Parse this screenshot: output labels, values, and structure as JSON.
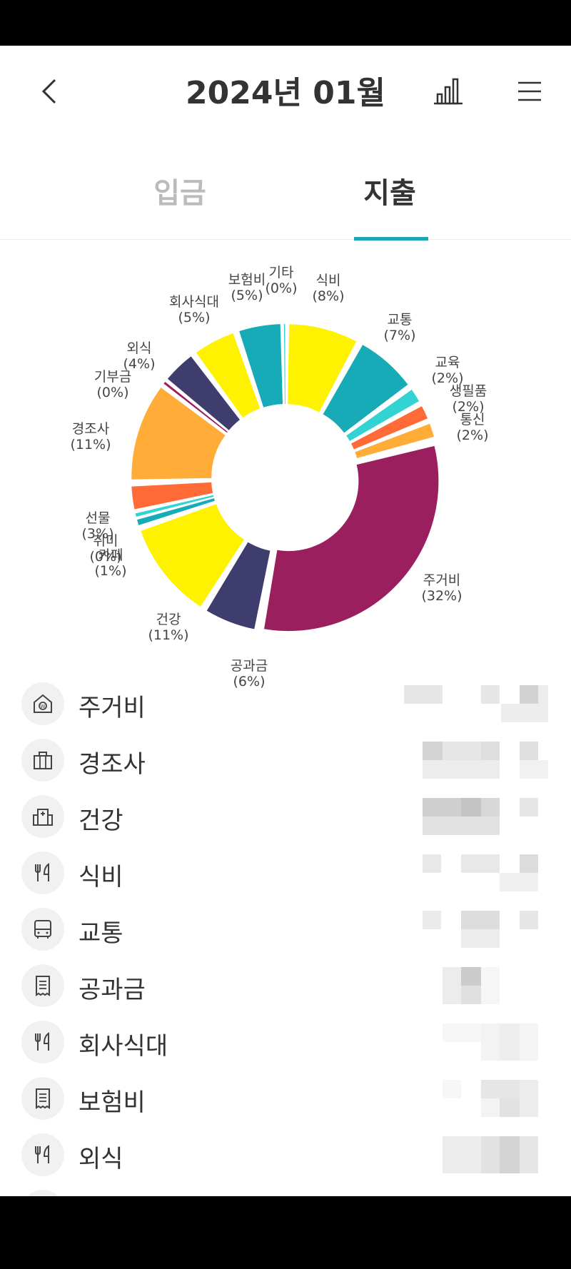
{
  "header": {
    "title": "2024년 01월",
    "back_icon": "chevron-left-icon",
    "chart_icon": "bar-chart-icon",
    "menu_icon": "hamburger-menu-icon"
  },
  "tabs": [
    {
      "label": "입금",
      "active": false
    },
    {
      "label": "지출",
      "active": true
    }
  ],
  "colors": {
    "accent": "#1aa6b5",
    "active_tab": "#333333",
    "inactive_tab": "#bbbbbb"
  },
  "chart_data": {
    "type": "pie",
    "style": "donut",
    "slices": [
      {
        "label": "식비",
        "pct": "(8%)",
        "value": 8,
        "color": "#fff200"
      },
      {
        "label": "교통",
        "pct": "(7%)",
        "value": 7,
        "color": "#17aab7"
      },
      {
        "label": "교육",
        "pct": "(2%)",
        "value": 2,
        "color": "#33d3d3"
      },
      {
        "label": "생필품",
        "pct": "(2%)",
        "value": 2,
        "color": "#ff6a37"
      },
      {
        "label": "통신",
        "pct": "(2%)",
        "value": 2,
        "color": "#ffac38"
      },
      {
        "label": "주거비",
        "pct": "(32%)",
        "value": 32,
        "color": "#9b1e5e"
      },
      {
        "label": "공과금",
        "pct": "(6%)",
        "value": 6,
        "color": "#3e3d6e"
      },
      {
        "label": "건강",
        "pct": "(11%)",
        "value": 11,
        "color": "#fff200"
      },
      {
        "label": "카페",
        "pct": "(1%)",
        "value": 1,
        "color": "#17aab7"
      },
      {
        "label": "취미",
        "pct": "(0%)",
        "value": 0.6,
        "color": "#33d3d3"
      },
      {
        "label": "선물",
        "pct": "(3%)",
        "value": 3,
        "color": "#ff6a37"
      },
      {
        "label": "경조사",
        "pct": "(11%)",
        "value": 11,
        "color": "#ffac38"
      },
      {
        "label": "기부금",
        "pct": "(0%)",
        "value": 0.4,
        "color": "#9b1e5e"
      },
      {
        "label": "외식",
        "pct": "(4%)",
        "value": 4,
        "color": "#3e3d6e"
      },
      {
        "label": "회사식대",
        "pct": "(5%)",
        "value": 5,
        "color": "#fff200"
      },
      {
        "label": "보험비",
        "pct": "(5%)",
        "value": 5,
        "color": "#17aab7"
      },
      {
        "label": "기타",
        "pct": "(0%)",
        "value": 0.2,
        "color": "#33d3d3"
      }
    ]
  },
  "categories": [
    {
      "label": "주거비",
      "icon": "house-icon"
    },
    {
      "label": "경조사",
      "icon": "gift-box-icon"
    },
    {
      "label": "건강",
      "icon": "hospital-icon"
    },
    {
      "label": "식비",
      "icon": "fork-knife-icon"
    },
    {
      "label": "교통",
      "icon": "bus-icon"
    },
    {
      "label": "공과금",
      "icon": "receipt-icon"
    },
    {
      "label": "회사식대",
      "icon": "fork-knife-icon"
    },
    {
      "label": "보험비",
      "icon": "receipt-icon"
    },
    {
      "label": "외식",
      "icon": "fork-knife-icon"
    }
  ]
}
